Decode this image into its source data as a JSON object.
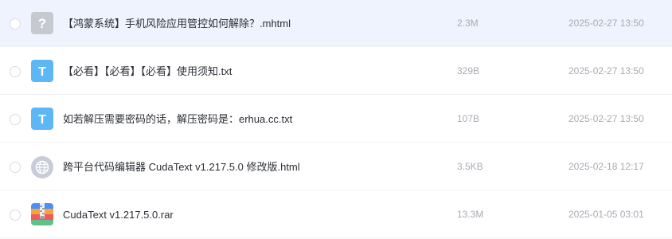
{
  "colors": {
    "selected_row_bg": "#eef3fe",
    "row_divider": "#eef0f4",
    "text_icon": "#5db7f5",
    "unknown_icon": "#c6c9d0",
    "web_icon": "#c7ccd8",
    "meta_text": "#a7abb3"
  },
  "files": [
    {
      "name": "【鸿蒙系统】手机风险应用管控如何解除？.mhtml",
      "size": "2.3M",
      "date": "2025-02-27 13:50",
      "icon": "unknown-file-icon",
      "icon_glyph": "?",
      "selected": true
    },
    {
      "name": "【必看】【必看】【必看】使用须知.txt",
      "size": "329B",
      "date": "2025-02-27 13:50",
      "icon": "text-file-icon",
      "icon_glyph": "T",
      "selected": false
    },
    {
      "name": "如若解压需要密码的话，解压密码是：erhua.cc.txt",
      "size": "107B",
      "date": "2025-02-27 13:50",
      "icon": "text-file-icon",
      "icon_glyph": "T",
      "selected": false
    },
    {
      "name": "跨平台代码编辑器 CudaText v1.217.5.0 修改版.html",
      "size": "3.5KB",
      "date": "2025-02-18 12:17",
      "icon": "web-file-icon",
      "selected": false
    },
    {
      "name": "CudaText v1.217.5.0.rar",
      "size": "13.3M",
      "date": "2025-01-05 03:01",
      "icon": "archive-file-icon",
      "selected": false
    }
  ]
}
